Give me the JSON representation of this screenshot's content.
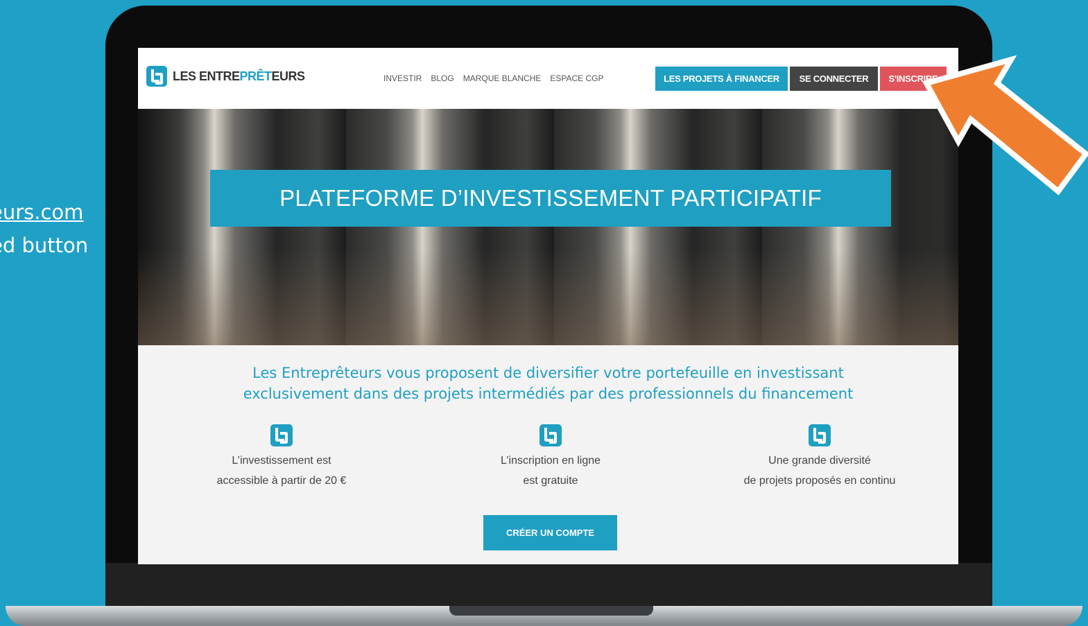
{
  "caption": {
    "line1": "eurs.com",
    "line2": "ed button"
  },
  "site": {
    "logo": {
      "text_dark_1": "LES ENTRE",
      "text_accent": "PRÊT",
      "text_dark_2": "EURS"
    },
    "nav": [
      "INVESTIR",
      "BLOG",
      "MARQUE BLANCHE",
      "ESPACE CGP"
    ],
    "buttons": {
      "projects": "LES PROJETS À FINANCER",
      "login": "SE CONNECTER",
      "signup": "S'INSCRIRE"
    },
    "hero_title": "PLATEFORME D’INVESTISSEMENT PARTICIPATIF",
    "tagline": {
      "line1": "Les Entreprêteurs vous proposent de diversifier votre portefeuille en investissant",
      "line2": "exclusivement dans des projets intermédiés par des professionnels du financement"
    },
    "features": [
      {
        "line1": "L’investissement est",
        "line2": "accessible à partir de 20 €"
      },
      {
        "line1": "L’inscription en ligne",
        "line2": "est gratuite"
      },
      {
        "line1": "Une grande diversité",
        "line2": "de projets proposés en continu"
      }
    ],
    "cta": "CRÉER UN COMPTE"
  },
  "colors": {
    "background": "#1fa0c6",
    "brand": "#1f9fc2",
    "signup": "#e0555b",
    "login": "#444444",
    "arrow": "#ef7f2f"
  }
}
